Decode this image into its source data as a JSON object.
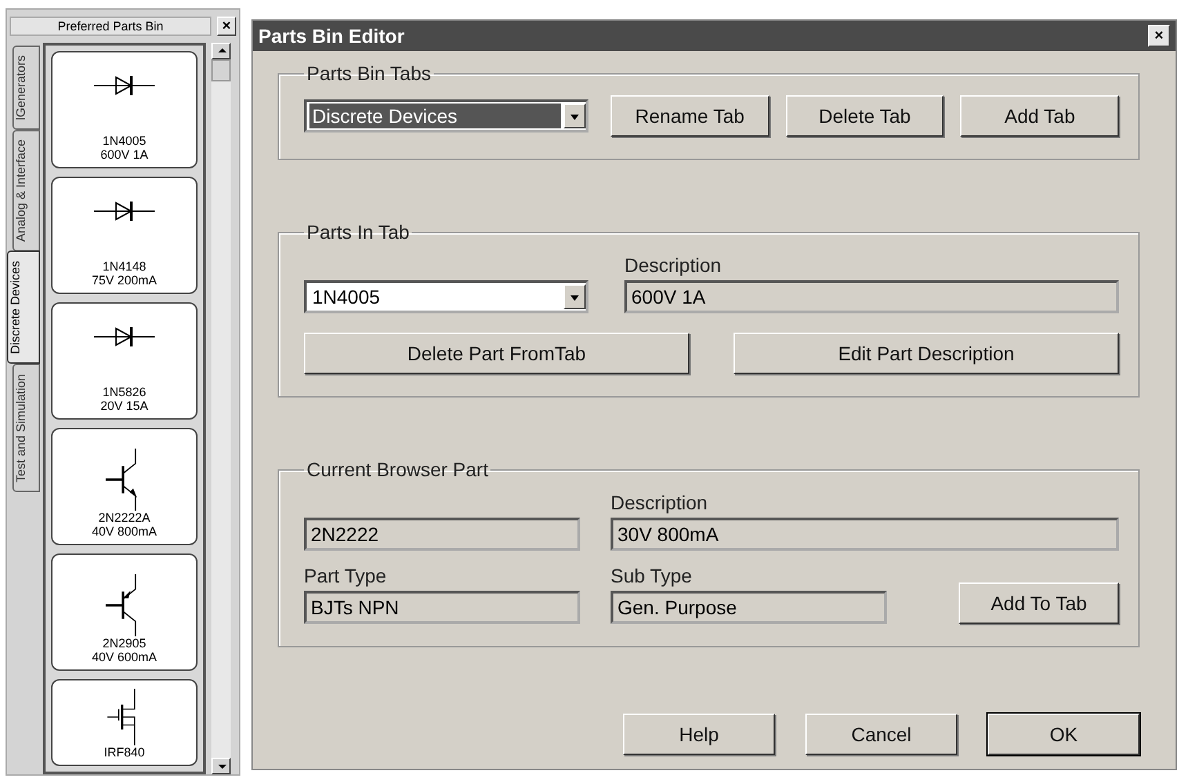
{
  "parts_bin": {
    "title": "Preferred Parts Bin",
    "close": "×",
    "tabs": [
      {
        "label": "lGenerators",
        "selected": false
      },
      {
        "label": "Analog & Interface",
        "selected": false
      },
      {
        "label": "Discrete Devices",
        "selected": true
      },
      {
        "label": "Test and Simulation",
        "selected": false
      }
    ],
    "parts": [
      {
        "kind": "diode",
        "name": "1N4005",
        "description": "600V 1A"
      },
      {
        "kind": "diode",
        "name": "1N4148",
        "description": "75V 200mA"
      },
      {
        "kind": "diode",
        "name": "1N5826",
        "description": "20V 15A"
      },
      {
        "kind": "npn",
        "name": "2N2222A",
        "description": "40V 800mA"
      },
      {
        "kind": "pnp",
        "name": "2N2905",
        "description": "40V 600mA"
      },
      {
        "kind": "mosfet",
        "name": "IRF840"
      }
    ]
  },
  "dialog": {
    "title": "Parts Bin Editor",
    "close": "×",
    "parts_bin_tabs": {
      "legend": "Parts Bin Tabs",
      "tab_value": "Discrete Devices",
      "buttons": [
        "Rename Tab",
        "Delete Tab",
        "Add Tab"
      ]
    },
    "parts_in_tab": {
      "legend": "Parts In Tab",
      "part_value": "1N4005",
      "description_label": "Description",
      "description_value": "600V 1A",
      "buttons": [
        "Delete Part FromTab",
        "Edit Part Description"
      ]
    },
    "current_browser_part": {
      "legend": "Current Browser Part",
      "part_value": "2N2222",
      "description_label": "Description",
      "description_value": "30V 800mA",
      "part_type_label": "Part Type",
      "part_type_value": "BJTs NPN",
      "sub_type_label": "Sub Type",
      "sub_type_value": "Gen. Purpose",
      "add_button": "Add To Tab"
    },
    "buttons": [
      {
        "label": "Help",
        "default": false
      },
      {
        "label": "Cancel",
        "default": false
      },
      {
        "label": "OK",
        "default": true
      }
    ]
  }
}
